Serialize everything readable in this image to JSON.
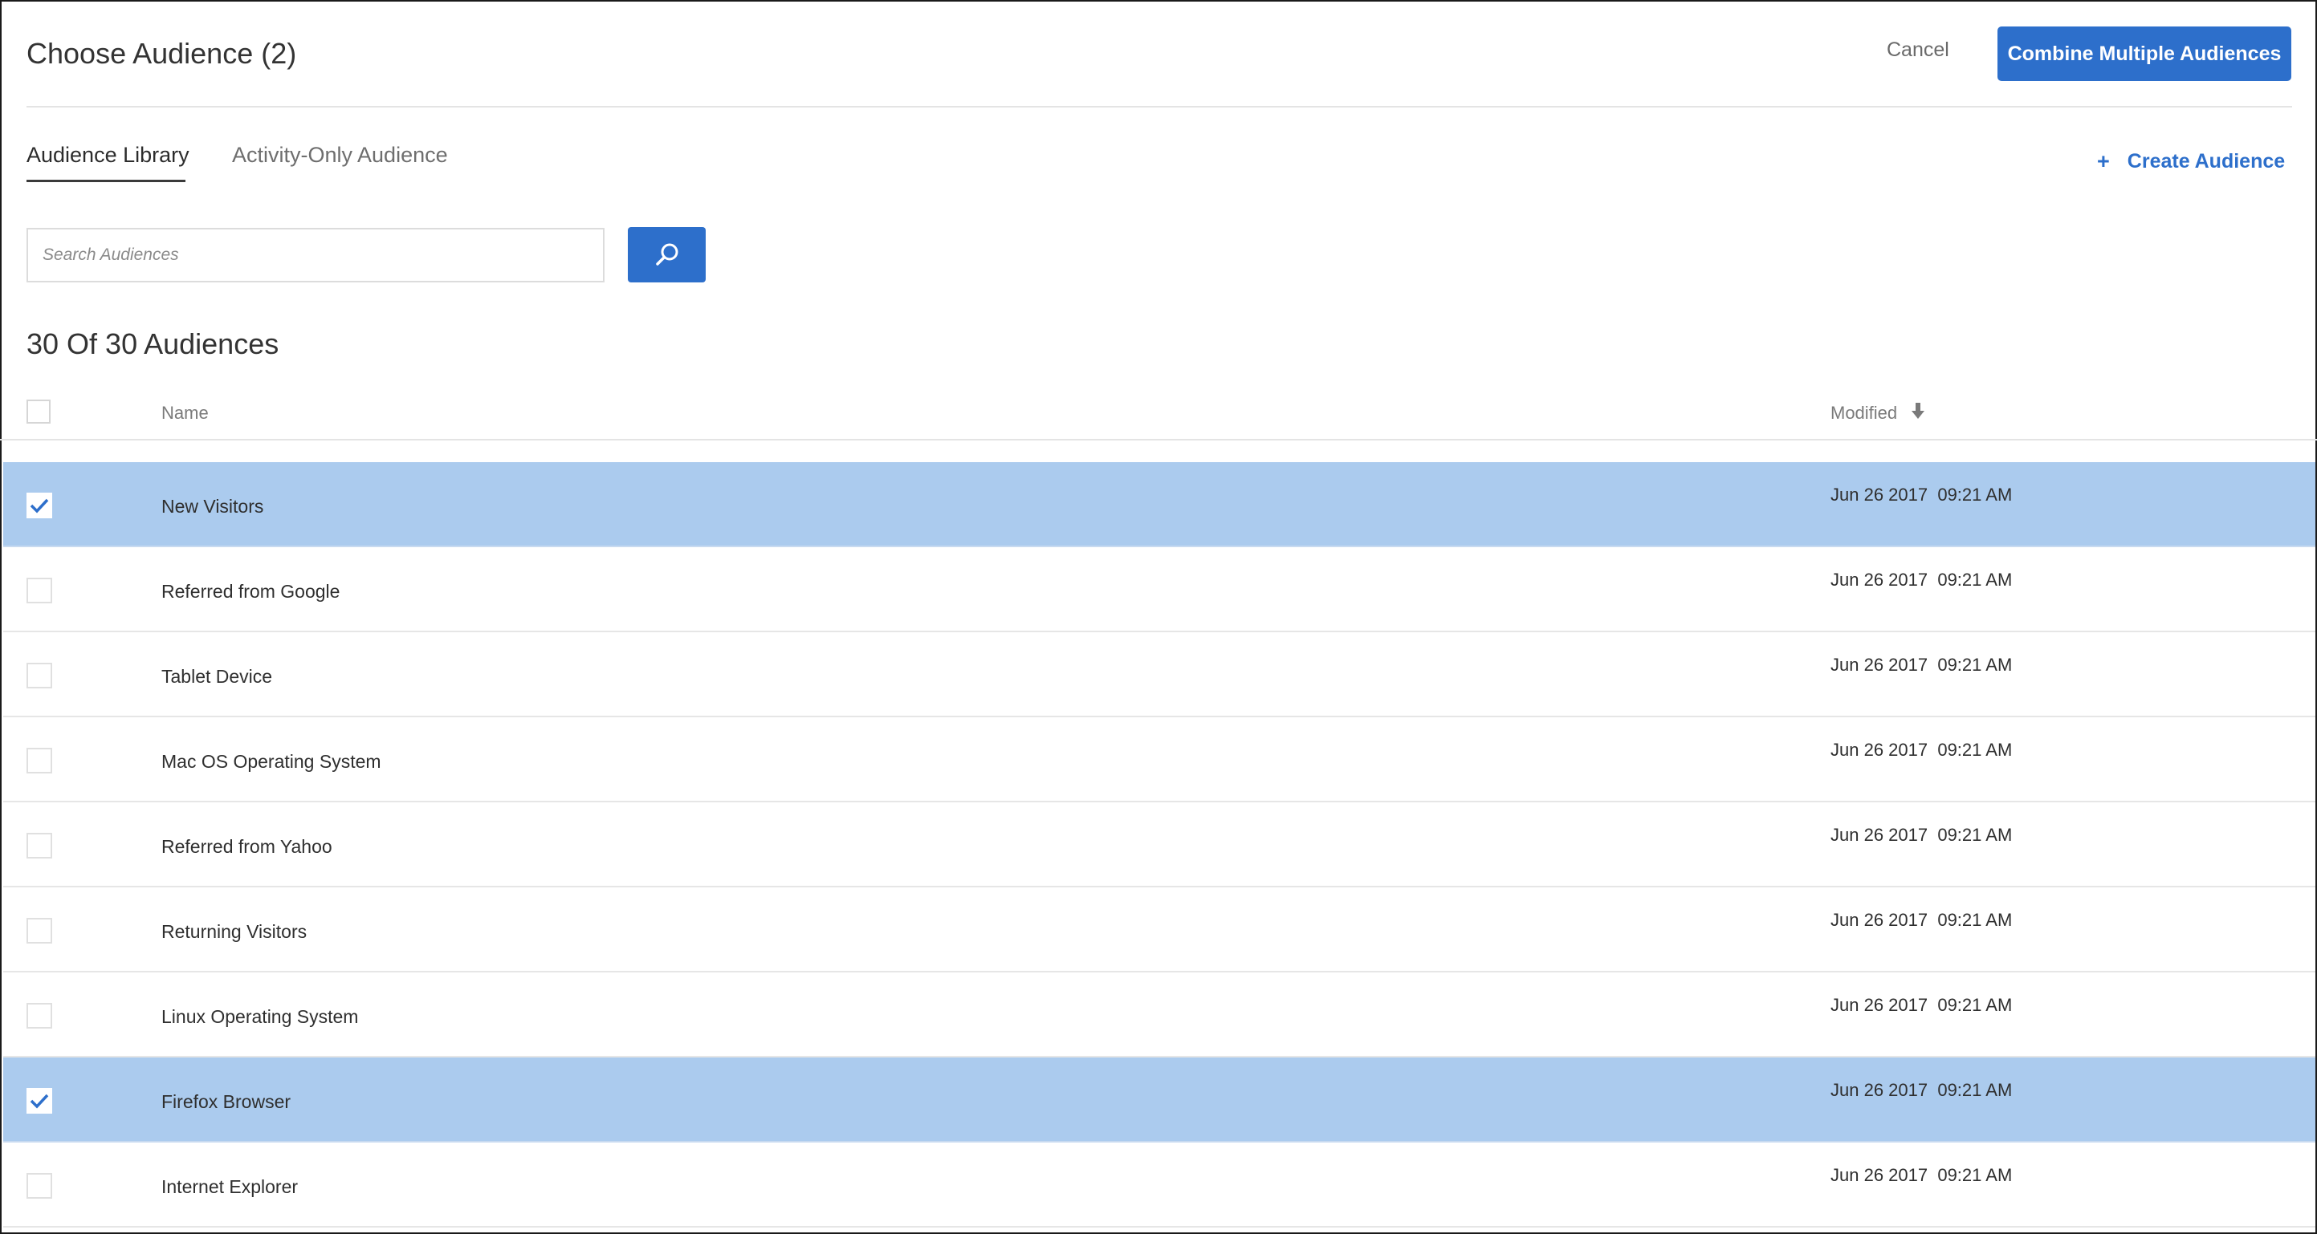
{
  "header": {
    "title": "Choose Audience (2)",
    "cancel_label": "Cancel",
    "combine_label": "Combine Multiple Audiences"
  },
  "tabs": [
    {
      "label": "Audience Library",
      "active": true
    },
    {
      "label": "Activity-Only Audience",
      "active": false
    }
  ],
  "create_audience": {
    "icon": "plus-icon",
    "label": "Create Audience"
  },
  "search": {
    "placeholder": "Search Audiences",
    "value": "",
    "button_icon": "search-icon"
  },
  "list": {
    "count_title": "30 Of 30 Audiences",
    "columns": {
      "name": "Name",
      "modified": "Modified",
      "sort_icon": "arrow-down-icon"
    },
    "rows": [
      {
        "name": "New Visitors",
        "modified": "Jun 26 2017  09:21 AM",
        "checked": true
      },
      {
        "name": "Referred from Google",
        "modified": "Jun 26 2017  09:21 AM",
        "checked": false
      },
      {
        "name": "Tablet Device",
        "modified": "Jun 26 2017  09:21 AM",
        "checked": false
      },
      {
        "name": "Mac OS Operating System",
        "modified": "Jun 26 2017  09:21 AM",
        "checked": false
      },
      {
        "name": "Referred from Yahoo",
        "modified": "Jun 26 2017  09:21 AM",
        "checked": false
      },
      {
        "name": "Returning Visitors",
        "modified": "Jun 26 2017  09:21 AM",
        "checked": false
      },
      {
        "name": "Linux Operating System",
        "modified": "Jun 26 2017  09:21 AM",
        "checked": false
      },
      {
        "name": "Firefox Browser",
        "modified": "Jun 26 2017  09:21 AM",
        "checked": true
      },
      {
        "name": "Internet Explorer",
        "modified": "Jun 26 2017  09:21 AM",
        "checked": false
      }
    ]
  },
  "colors": {
    "accent": "#2d6fcb",
    "selected_row": "#abcbee"
  }
}
